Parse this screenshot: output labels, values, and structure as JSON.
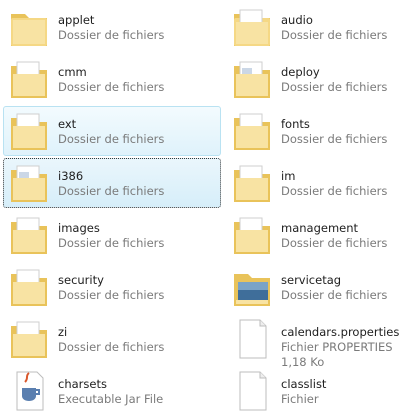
{
  "files": [
    {
      "name": "applet",
      "type": "Dossier de fichiers",
      "icon": "folder-icon"
    },
    {
      "name": "audio",
      "type": "Dossier de fichiers",
      "icon": "folder-icon"
    },
    {
      "name": "cmm",
      "type": "Dossier de fichiers",
      "icon": "folder-documents-icon"
    },
    {
      "name": "deploy",
      "type": "Dossier de fichiers",
      "icon": "folder-documents-icon"
    },
    {
      "name": "ext",
      "type": "Dossier de fichiers",
      "icon": "folder-documents-icon",
      "state": "hover"
    },
    {
      "name": "fonts",
      "type": "Dossier de fichiers",
      "icon": "folder-documents-icon"
    },
    {
      "name": "i386",
      "type": "Dossier de fichiers",
      "icon": "folder-documents-icon",
      "state": "selected"
    },
    {
      "name": "im",
      "type": "Dossier de fichiers",
      "icon": "folder-documents-icon"
    },
    {
      "name": "images",
      "type": "Dossier de fichiers",
      "icon": "folder-documents-icon"
    },
    {
      "name": "management",
      "type": "Dossier de fichiers",
      "icon": "folder-documents-icon"
    },
    {
      "name": "security",
      "type": "Dossier de fichiers",
      "icon": "folder-documents-icon"
    },
    {
      "name": "servicetag",
      "type": "Dossier de fichiers",
      "icon": "folder-image-icon"
    },
    {
      "name": "zi",
      "type": "Dossier de fichiers",
      "icon": "folder-documents-icon"
    },
    {
      "name": "calendars.properties",
      "type": "Fichier PROPERTIES",
      "size": "1,18 Ko",
      "icon": "file-icon"
    },
    {
      "name": "charsets",
      "type": "Executable Jar File",
      "size": "",
      "icon": "java-jar-icon"
    },
    {
      "name": "classlist",
      "type": "Fichier",
      "size": "",
      "icon": "file-icon"
    }
  ],
  "colors": {
    "hover_bg": "#dff2fb",
    "selected_bg": "#d6eef9",
    "folder_yellow": "#f1d57a"
  }
}
